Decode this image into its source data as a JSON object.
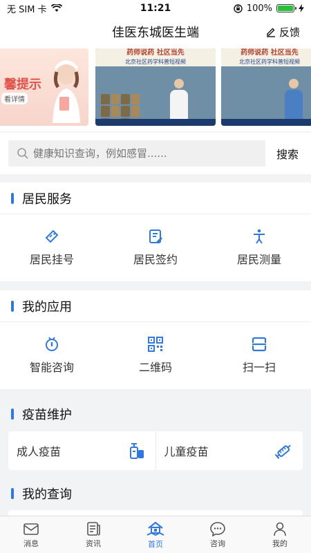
{
  "status_bar": {
    "carrier": "无 SIM 卡",
    "time": "11:21",
    "battery": "100%"
  },
  "header": {
    "title": "佳医东城医生端",
    "feedback_label": "反馈"
  },
  "banner": {
    "slide1_title": "馨提示",
    "slide1_sub": "看详情",
    "slide2_head": "药师说药 社区当先",
    "slide2_sub": "北京社区药学科普短视频",
    "slide3_head": "药师说药 社区当先",
    "slide3_sub": "北京社区药学科普短视频"
  },
  "search": {
    "placeholder": "健康知识查询，例如感冒......",
    "button_label": "搜索"
  },
  "resident_services": {
    "title": "居民服务",
    "items": [
      {
        "label": "居民挂号",
        "icon": "ticket-icon"
      },
      {
        "label": "居民签约",
        "icon": "contract-icon"
      },
      {
        "label": "居民测量",
        "icon": "measure-icon"
      }
    ]
  },
  "my_apps": {
    "title": "我的应用",
    "items": [
      {
        "label": "智能咨询",
        "icon": "smart-consult-icon"
      },
      {
        "label": "二维码",
        "icon": "qrcode-icon"
      },
      {
        "label": "扫一扫",
        "icon": "scan-icon"
      }
    ]
  },
  "vaccine": {
    "title": "疫苗维护",
    "items": [
      {
        "label": "成人疫苗",
        "icon": "adult-vaccine-icon"
      },
      {
        "label": "儿童疫苗",
        "icon": "child-vaccine-icon"
      }
    ]
  },
  "my_query": {
    "title": "我的查询"
  },
  "tabbar": {
    "tabs": [
      {
        "label": "消息",
        "icon": "message-icon"
      },
      {
        "label": "资讯",
        "icon": "news-icon"
      },
      {
        "label": "首页",
        "icon": "home-icon"
      },
      {
        "label": "咨询",
        "icon": "consult-icon"
      },
      {
        "label": "我的",
        "icon": "profile-icon"
      }
    ],
    "active": "首页"
  },
  "colors": {
    "accent": "#2f78e0",
    "battery": "#27c13a"
  }
}
